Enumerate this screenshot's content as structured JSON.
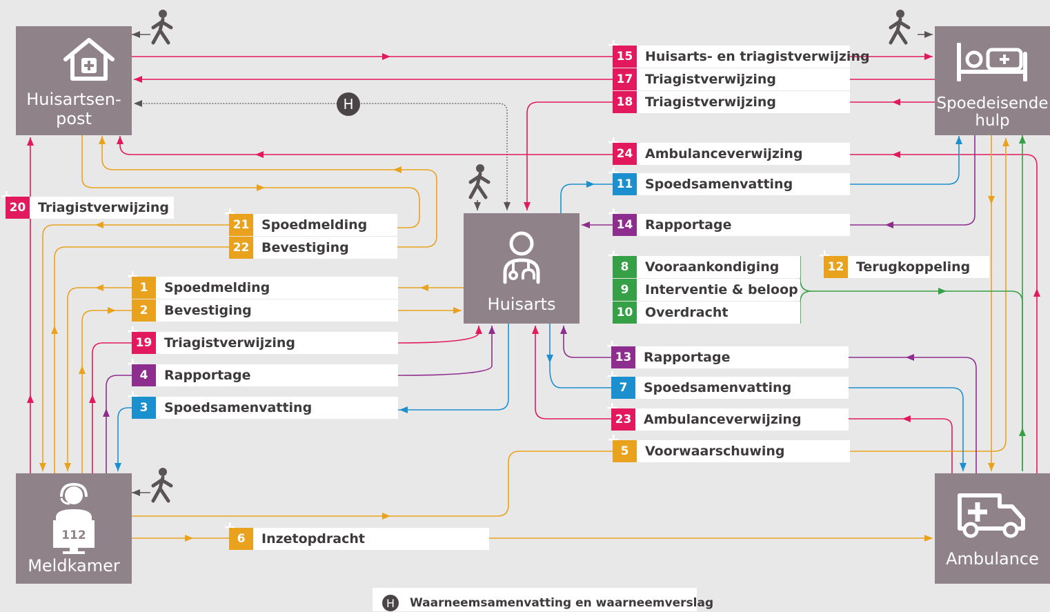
{
  "colors": {
    "pink": "#e2195d",
    "orange": "#e9a21d",
    "purple": "#8d2d8d",
    "blue": "#1c8fcf",
    "green": "#35a045",
    "node": "#8f8288",
    "line_gray": "#5a5356"
  },
  "nodes": {
    "huisartsenpost": {
      "label": "Huisartsen-\npost",
      "icon": "house-medical-icon"
    },
    "spoedeisende_hulp": {
      "label": "Spoedeisende\nhulp",
      "icon": "hospital-bed-icon"
    },
    "huisarts": {
      "label": "Huisarts",
      "icon": "doctor-icon"
    },
    "meldkamer": {
      "label": "Meldkamer",
      "icon": "dispatcher-icon",
      "screen_text": "112"
    },
    "ambulance": {
      "label": "Ambulance",
      "icon": "ambulance-icon"
    }
  },
  "flows": [
    {
      "id": "f15",
      "num": "15",
      "label": "Huisarts- en triagistverwijzing",
      "color": "pink"
    },
    {
      "id": "f17",
      "num": "17",
      "label": "Triagistverwijzing",
      "color": "pink"
    },
    {
      "id": "f18",
      "num": "18",
      "label": "Triagistverwijzing",
      "color": "pink"
    },
    {
      "id": "f24",
      "num": "24",
      "label": "Ambulanceverwijzing",
      "color": "pink"
    },
    {
      "id": "f11",
      "num": "11",
      "label": "Spoedsamenvatting",
      "color": "blue"
    },
    {
      "id": "f14",
      "num": "14",
      "label": "Rapportage",
      "color": "purple"
    },
    {
      "id": "f8",
      "num": "8",
      "label": "Vooraankondiging",
      "color": "green"
    },
    {
      "id": "f9",
      "num": "9",
      "label": "Interventie & beloop",
      "color": "green"
    },
    {
      "id": "f10",
      "num": "10",
      "label": "Overdracht",
      "color": "green"
    },
    {
      "id": "f12",
      "num": "12",
      "label": "Terugkoppeling",
      "color": "orange"
    },
    {
      "id": "f20",
      "num": "20",
      "label": "Triagistverwijzing",
      "color": "pink"
    },
    {
      "id": "f21",
      "num": "21",
      "label": "Spoedmelding",
      "color": "orange"
    },
    {
      "id": "f22",
      "num": "22",
      "label": "Bevestiging",
      "color": "orange"
    },
    {
      "id": "f1",
      "num": "1",
      "label": "Spoedmelding",
      "color": "orange"
    },
    {
      "id": "f2",
      "num": "2",
      "label": "Bevestiging",
      "color": "orange"
    },
    {
      "id": "f19",
      "num": "19",
      "label": "Triagistverwijzing",
      "color": "pink"
    },
    {
      "id": "f4",
      "num": "4",
      "label": "Rapportage",
      "color": "purple"
    },
    {
      "id": "f3",
      "num": "3",
      "label": "Spoedsamenvatting",
      "color": "blue"
    },
    {
      "id": "f13",
      "num": "13",
      "label": "Rapportage",
      "color": "purple"
    },
    {
      "id": "f7",
      "num": "7",
      "label": "Spoedsamenvatting",
      "color": "blue"
    },
    {
      "id": "f23",
      "num": "23",
      "label": "Ambulanceverwijzing",
      "color": "pink"
    },
    {
      "id": "f5",
      "num": "5",
      "label": "Voorwaarschuwing",
      "color": "orange"
    },
    {
      "id": "f6",
      "num": "6",
      "label": "Inzetopdracht",
      "color": "orange"
    }
  ],
  "legend": {
    "symbol": "H",
    "text": "Waarneemsamenvatting en waarneemverslag"
  }
}
